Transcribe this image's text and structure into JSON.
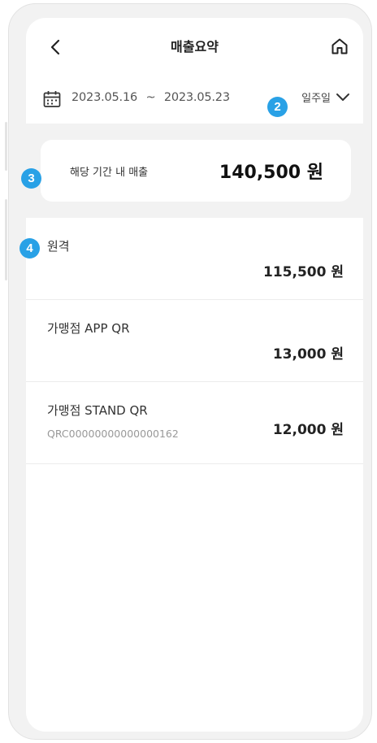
{
  "header": {
    "title": "매출요약",
    "back_icon": "chevron-left-icon",
    "home_icon": "home-icon"
  },
  "date_range": {
    "icon": "calendar-icon",
    "start": "2023.05.16",
    "separator": "~",
    "end": "2023.05.23",
    "period_label": "일주일"
  },
  "summary": {
    "label": "해당 기간 내 매출",
    "value": "140,500 원"
  },
  "items": [
    {
      "name": "원격",
      "sub": "",
      "amount": "115,500 원"
    },
    {
      "name": "가맹점 APP QR",
      "sub": "",
      "amount": "13,000 원"
    },
    {
      "name": "가맹점 STAND QR",
      "sub": "QRC00000000000000162",
      "amount": "12,000 원"
    }
  ],
  "badges": [
    "2",
    "3",
    "4"
  ],
  "colors": {
    "badge": "#29a1e6",
    "frame": "#f2f2f2",
    "text_primary": "#222222",
    "text_muted": "#999999"
  }
}
